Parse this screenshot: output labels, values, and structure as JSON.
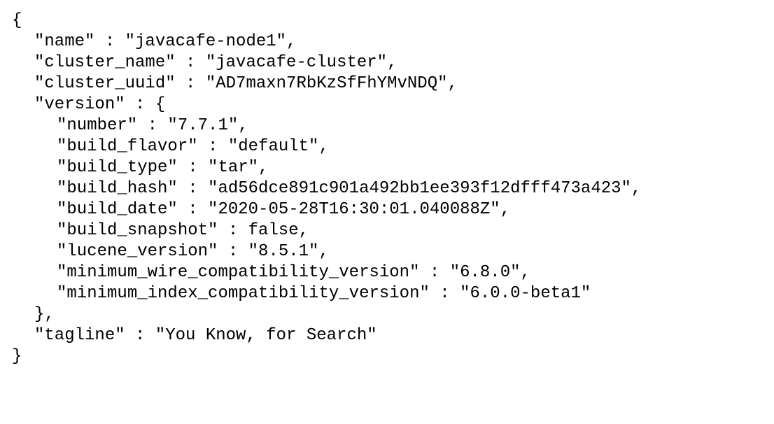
{
  "lines": {
    "open_brace": "{",
    "name": "\"name\" : \"javacafe-node1\",",
    "cluster_name": "\"cluster_name\" : \"javacafe-cluster\",",
    "cluster_uuid": "\"cluster_uuid\" : \"AD7maxn7RbKzSfFhYMvNDQ\",",
    "version_open": "\"version\" : {",
    "number": "\"number\" : \"7.7.1\",",
    "build_flavor": "\"build_flavor\" : \"default\",",
    "build_type": "\"build_type\" : \"tar\",",
    "build_hash": "\"build_hash\" : \"ad56dce891c901a492bb1ee393f12dfff473a423\",",
    "build_date": "\"build_date\" : \"2020-05-28T16:30:01.040088Z\",",
    "build_snapshot": "\"build_snapshot\" : false,",
    "lucene_version": "\"lucene_version\" : \"8.5.1\",",
    "min_wire": "\"minimum_wire_compatibility_version\" : \"6.8.0\",",
    "min_index": "\"minimum_index_compatibility_version\" : \"6.0.0-beta1\"",
    "version_close": "},",
    "tagline": "\"tagline\" : \"You Know, for Search\"",
    "close_brace": "}"
  }
}
